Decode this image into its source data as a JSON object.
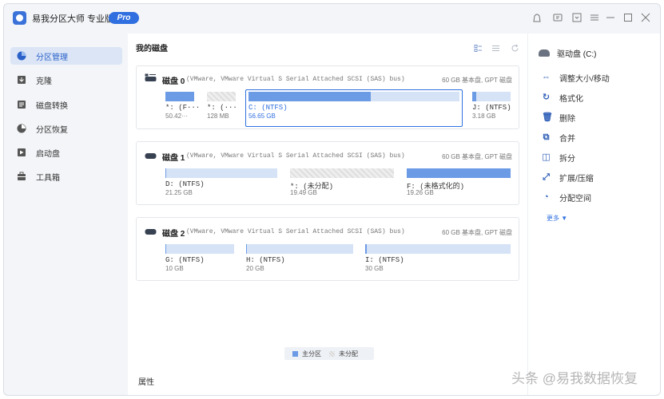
{
  "app": {
    "title": "易我分区大师 专业版",
    "pro": "Pro"
  },
  "titlebar": {
    "icons": [
      "skin-icon",
      "feedback-icon",
      "window-icon",
      "menu-icon",
      "minimize-icon",
      "maximize-icon",
      "close-icon"
    ]
  },
  "sidebar": {
    "items": [
      {
        "label": "分区管理",
        "icon": "partition-icon",
        "active": true
      },
      {
        "label": "克隆",
        "icon": "clone-icon"
      },
      {
        "label": "磁盘转换",
        "icon": "convert-icon"
      },
      {
        "label": "分区恢复",
        "icon": "recovery-icon"
      },
      {
        "label": "启动盘",
        "icon": "bootdisk-icon"
      },
      {
        "label": "工具箱",
        "icon": "toolbox-icon"
      }
    ]
  },
  "main": {
    "title": "我的磁盘",
    "disks": [
      {
        "name": "磁盘 0",
        "desc": "(VMware, VMware Virtual S Serial Attached SCSI (SAS) bus)",
        "meta": "60 GB 基本盘, GPT 磁盘",
        "partitions": [
          {
            "name": "*: (F···",
            "size": "50.42···",
            "fill": 1.0
          },
          {
            "name": "*: (···",
            "size": "128 MB",
            "unallocated": true
          },
          {
            "name": "C: (NTFS)",
            "size": "56.65 GB",
            "fill": 0.58,
            "selected": true
          },
          {
            "name": "J: (NTFS)",
            "size": "3.18 GB",
            "fill": 0.1
          }
        ]
      },
      {
        "name": "磁盘 1",
        "desc": "(VMware, VMware Virtual S Serial Attached SCSI (SAS) bus)",
        "meta": "60 GB 基本盘, GPT 磁盘",
        "partitions": [
          {
            "name": "D: (NTFS)",
            "size": "21.25 GB",
            "fill": 0.01
          },
          {
            "name": "*: (未分配)",
            "size": "19.49 GB",
            "unallocated": true
          },
          {
            "name": "F: (未格式化的)",
            "size": "19.26 GB",
            "fill": 1.0
          }
        ]
      },
      {
        "name": "磁盘 2",
        "desc": "(VMware, VMware Virtual S Serial Attached SCSI (SAS) bus)",
        "meta": "60 GB 基本盘, GPT 磁盘",
        "partitions": [
          {
            "name": "G: (NTFS)",
            "size": "10 GB",
            "fill": 0.01
          },
          {
            "name": "H: (NTFS)",
            "size": "20 GB",
            "fill": 0.01
          },
          {
            "name": "I: (NTFS)",
            "size": "30 GB",
            "fill": 0.01
          }
        ]
      }
    ],
    "legend": {
      "allocated": "主分区",
      "unallocated": "未分配",
      "allocated_color": "#6c9be6"
    },
    "properties": "属性"
  },
  "panel": {
    "drive": "驱动盘  (C:)",
    "actions": [
      {
        "label": "调整大小/移动",
        "icon": "resize-icon",
        "glyph": "⇔"
      },
      {
        "label": "格式化",
        "icon": "format-icon",
        "glyph": "↻"
      },
      {
        "label": "删除",
        "icon": "delete-icon",
        "glyph": "🗑"
      },
      {
        "label": "合并",
        "icon": "merge-icon",
        "glyph": "⧉"
      },
      {
        "label": "拆分",
        "icon": "split-icon",
        "glyph": "◫"
      },
      {
        "label": "扩展/压缩",
        "icon": "extend-icon",
        "glyph": "⤢"
      },
      {
        "label": "分配空间",
        "icon": "allocate-icon",
        "glyph": "◔"
      }
    ],
    "more": "更多 ▼"
  },
  "watermark": "头条 @易我数据恢复",
  "colors": {
    "accent": "#2f6fe0",
    "partition_fill": "#6c9be6",
    "partition_bg": "#d6e2f5"
  }
}
